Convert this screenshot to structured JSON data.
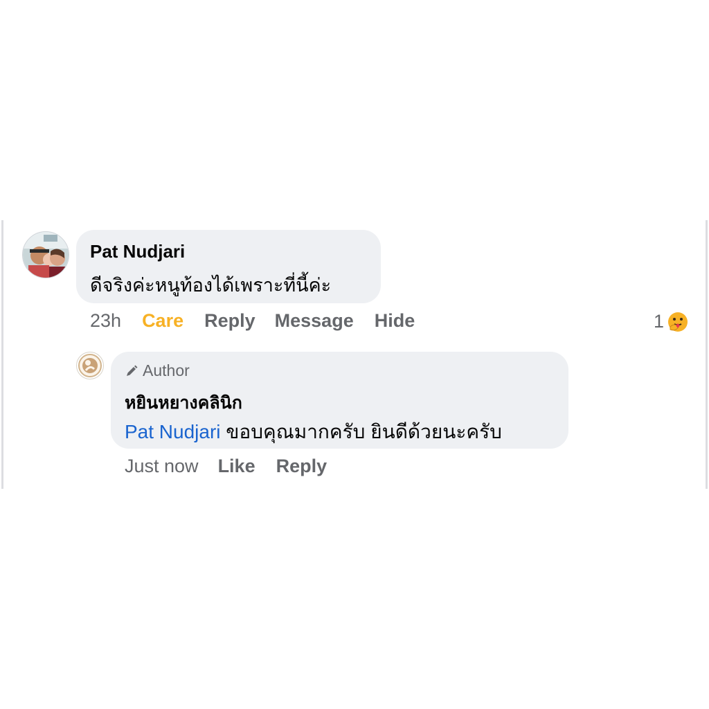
{
  "comment": {
    "author": "Pat Nudjari",
    "text": "ดีจริงค่ะหนูท้องได้เพราะที่นี้ค่ะ",
    "time": "23h",
    "actions": {
      "care": "Care",
      "reply": "Reply",
      "message": "Message",
      "hide": "Hide"
    },
    "reaction_count": "1",
    "reaction_icon": "care-reaction-icon",
    "colors": {
      "care": "#f7b125",
      "meta": "#65676b",
      "bubble": "#eef0f3"
    }
  },
  "reply": {
    "badge": "Author",
    "badge_icon": "pencil-icon",
    "author": "หยินหยางคลินิก",
    "mention": "Pat Nudjari",
    "text": " ขอบคุณมากครับ ยินดีด้วยนะครับ",
    "time": "Just now",
    "actions": {
      "like": "Like",
      "reply": "Reply"
    },
    "colors": {
      "mention": "#1a64cf"
    }
  }
}
